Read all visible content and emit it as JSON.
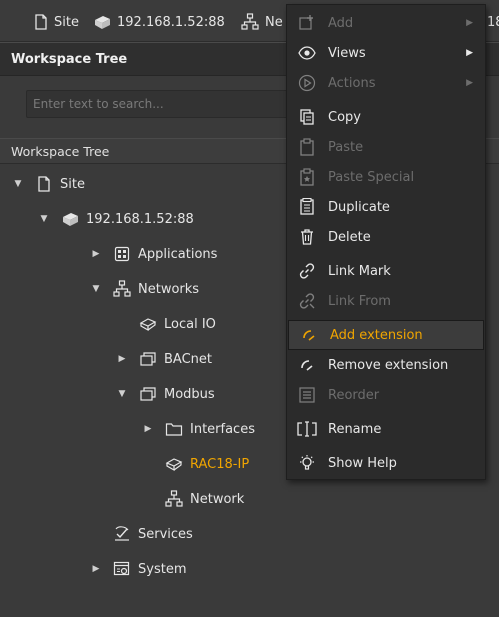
{
  "breadcrumb": {
    "site": "Site",
    "device": "192.168.1.52:88",
    "networks_partial": "Ne",
    "right_fragment": "18"
  },
  "panel": {
    "title": "Workspace Tree",
    "search_placeholder": "Enter text to search...",
    "tree_header": "Workspace Tree"
  },
  "tree": {
    "site": "Site",
    "device": "192.168.1.52:88",
    "applications": "Applications",
    "networks": "Networks",
    "local_io": "Local IO",
    "bacnet": "BACnet",
    "modbus": "Modbus",
    "interfaces": "Interfaces",
    "rac18": "RAC18-IP",
    "network": "Network",
    "services": "Services",
    "system": "System"
  },
  "menu": {
    "add": "Add",
    "views": "Views",
    "actions": "Actions",
    "copy": "Copy",
    "paste": "Paste",
    "paste_special": "Paste Special",
    "duplicate": "Duplicate",
    "delete": "Delete",
    "link_mark": "Link Mark",
    "link_from": "Link From",
    "add_extension": "Add extension",
    "remove_extension": "Remove extension",
    "reorder": "Reorder",
    "rename": "Rename",
    "show_help": "Show Help"
  },
  "colors": {
    "accent": "#f0a500",
    "background": "#3a3a3a",
    "menu_background": "#2b2b2b",
    "disabled_text": "#6d6d6d"
  }
}
